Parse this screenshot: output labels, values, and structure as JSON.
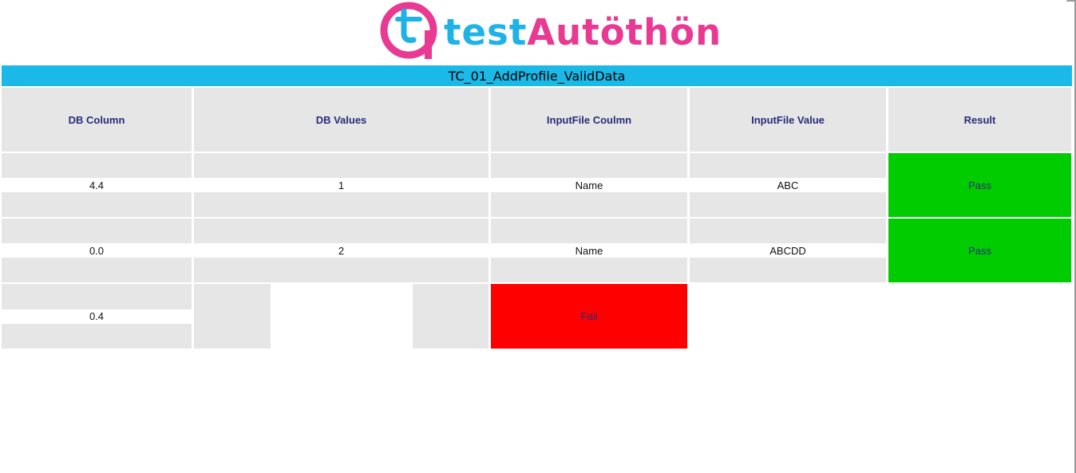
{
  "logo": {
    "mark": "t",
    "word_part1": "test",
    "word_part2": "Autöthön",
    "colors": {
      "blue": "#1fb2e6",
      "pink": "#e83a93"
    }
  },
  "report": {
    "title": "TC_01_AddProfile_ValidData",
    "banner_color": "#1ab9e8",
    "headers": [
      "DB Column",
      "DB Values",
      "InputFile Coulmn",
      "InputFile Value",
      "Result"
    ],
    "rows": [
      {
        "db_column": "4.4",
        "db_value": "1",
        "input_column": "Name",
        "input_value": "ABC",
        "result": "Pass"
      },
      {
        "db_column": "0.0",
        "db_value": "2",
        "input_column": "Name",
        "input_value": "ABCDD",
        "result": "Pass"
      },
      {
        "db_column": "0.4",
        "db_value": "",
        "extra_result": "Fail"
      }
    ],
    "status_colors": {
      "pass": "#00cc00",
      "fail": "#ff0000"
    }
  }
}
